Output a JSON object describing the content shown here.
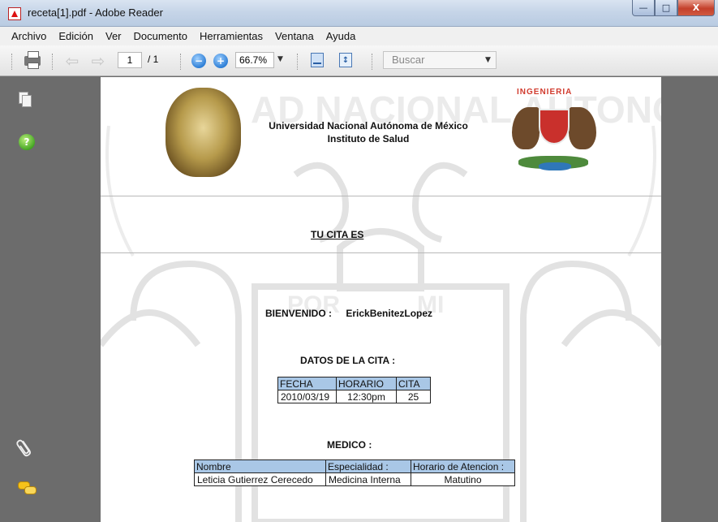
{
  "window": {
    "title": "receta[1].pdf - Adobe Reader",
    "controls": {
      "minimize": "—",
      "maximize": "□",
      "close": "X"
    }
  },
  "menu": [
    "Archivo",
    "Edición",
    "Ver",
    "Documento",
    "Herramientas",
    "Ventana",
    "Ayuda"
  ],
  "toolbar": {
    "page_current": "1",
    "page_total": "/ 1",
    "zoom": "66.7%",
    "search_placeholder": "Buscar",
    "zoom_out_symbol": "−",
    "zoom_in_symbol": "+",
    "prev_symbol": "⇦",
    "next_symbol": "⇨",
    "fit_page_symbol": "↕"
  },
  "sidebar": {
    "icons": [
      "pages-icon",
      "help-icon",
      "attachments-icon",
      "comments-icon"
    ],
    "help_symbol": "?",
    "attach_symbol": "⌀"
  },
  "document": {
    "seal_right_text": "INGENIERIA",
    "header_line1": "Universidad Nacional Autónoma de México",
    "header_line2": "Instituto de Salud",
    "cita_title": "TU CITA ES",
    "welcome_label": "BIENVENIDO :",
    "welcome_name": "ErickBenitezLopez",
    "datos_title": "DATOS DE LA CITA :",
    "cita_table": {
      "headers": [
        "FECHA",
        "HORARIO",
        "CITA"
      ],
      "row": [
        "2010/03/19",
        "12:30pm",
        "25"
      ]
    },
    "medico_title": "MEDICO :",
    "medico_table": {
      "headers": [
        "Nombre",
        "Especialidad :",
        "Horario de Atencion :"
      ],
      "row": [
        "Leticia Gutierrez Cerecedo",
        "Medicina Interna",
        "Matutino"
      ]
    },
    "watermark_text": "AD NACIONAL AUTONOM",
    "watermark_motto": "POR MI RAZA"
  },
  "colors": {
    "viewer_gray": "#6c6c6c",
    "table_header": "#a9c7e6",
    "seal_red": "#c9302c"
  }
}
